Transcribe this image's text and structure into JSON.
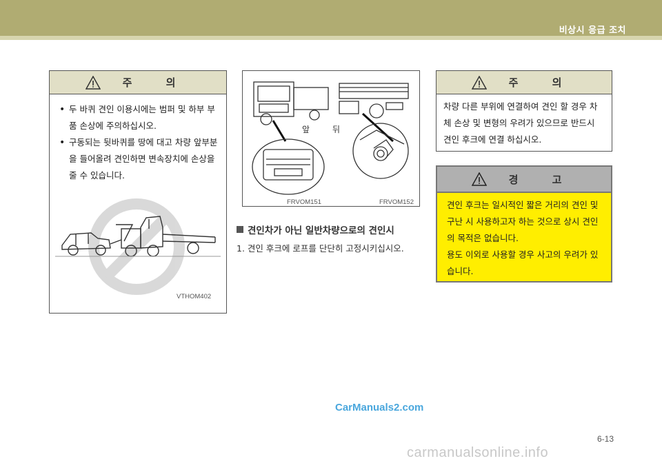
{
  "header": {
    "section_title": "비상시 응급 조치"
  },
  "left_caution": {
    "title": "주 의",
    "bullets": [
      "두 바퀴 견인 이용시에는 범퍼 및 하부 부품 손상에 주의하십시오.",
      "구동되는 뒷바퀴를 땅에 대고 차량 앞부분을 들어올려 견인하면 변속장치에 손상을 줄 수 있습니다."
    ],
    "image_code": "VTHOM402"
  },
  "center": {
    "front_label": "앞",
    "rear_label": "뒤",
    "image_code_left": "FRVOM151",
    "image_code_right": "FRVOM152",
    "subheading": "견인차가 아닌 일반차량으로의 견인시",
    "step_1": "1.  견인 후크에 로프를 단단히 고정시키십시오."
  },
  "right_caution": {
    "title": "주 의",
    "text": "차량 다른 부위에 연결하여 견인 할 경우 차체 손상 및 변형의 우려가 있으므로 반드시 견인 후크에 연결 하십시오."
  },
  "warning": {
    "title": "경 고",
    "lines": [
      "견인 후크는 일시적인 짧은 거리의 견인 및 구난 시 사용하고자 하는 것으로 상시 견인의 목적은 없습니다.",
      "용도 이외로 사용할 경우 사고의 우려가 있습니다."
    ]
  },
  "footer": {
    "page_number": "6-13",
    "watermark_1": "CarManuals2.com",
    "watermark_2": "carmanualsonline.info"
  },
  "colors": {
    "header_bar": "#b0ac72",
    "warning_fill": "#ffee00",
    "caution_header": "#e1dfc6"
  }
}
